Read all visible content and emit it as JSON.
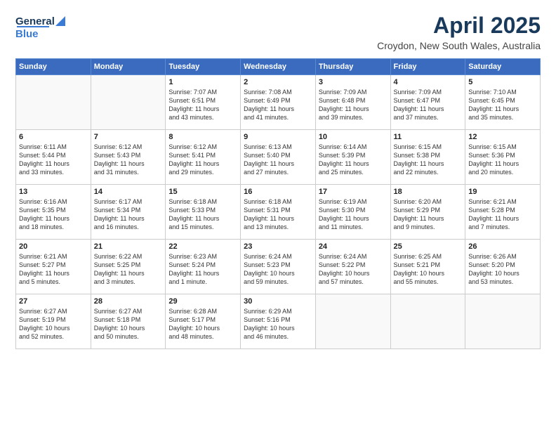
{
  "header": {
    "logo_general": "General",
    "logo_blue": "Blue",
    "title": "April 2025",
    "subtitle": "Croydon, New South Wales, Australia"
  },
  "weekdays": [
    "Sunday",
    "Monday",
    "Tuesday",
    "Wednesday",
    "Thursday",
    "Friday",
    "Saturday"
  ],
  "weeks": [
    [
      {
        "day": "",
        "lines": []
      },
      {
        "day": "",
        "lines": []
      },
      {
        "day": "1",
        "lines": [
          "Sunrise: 7:07 AM",
          "Sunset: 6:51 PM",
          "Daylight: 11 hours",
          "and 43 minutes."
        ]
      },
      {
        "day": "2",
        "lines": [
          "Sunrise: 7:08 AM",
          "Sunset: 6:49 PM",
          "Daylight: 11 hours",
          "and 41 minutes."
        ]
      },
      {
        "day": "3",
        "lines": [
          "Sunrise: 7:09 AM",
          "Sunset: 6:48 PM",
          "Daylight: 11 hours",
          "and 39 minutes."
        ]
      },
      {
        "day": "4",
        "lines": [
          "Sunrise: 7:09 AM",
          "Sunset: 6:47 PM",
          "Daylight: 11 hours",
          "and 37 minutes."
        ]
      },
      {
        "day": "5",
        "lines": [
          "Sunrise: 7:10 AM",
          "Sunset: 6:45 PM",
          "Daylight: 11 hours",
          "and 35 minutes."
        ]
      }
    ],
    [
      {
        "day": "6",
        "lines": [
          "Sunrise: 6:11 AM",
          "Sunset: 5:44 PM",
          "Daylight: 11 hours",
          "and 33 minutes."
        ]
      },
      {
        "day": "7",
        "lines": [
          "Sunrise: 6:12 AM",
          "Sunset: 5:43 PM",
          "Daylight: 11 hours",
          "and 31 minutes."
        ]
      },
      {
        "day": "8",
        "lines": [
          "Sunrise: 6:12 AM",
          "Sunset: 5:41 PM",
          "Daylight: 11 hours",
          "and 29 minutes."
        ]
      },
      {
        "day": "9",
        "lines": [
          "Sunrise: 6:13 AM",
          "Sunset: 5:40 PM",
          "Daylight: 11 hours",
          "and 27 minutes."
        ]
      },
      {
        "day": "10",
        "lines": [
          "Sunrise: 6:14 AM",
          "Sunset: 5:39 PM",
          "Daylight: 11 hours",
          "and 25 minutes."
        ]
      },
      {
        "day": "11",
        "lines": [
          "Sunrise: 6:15 AM",
          "Sunset: 5:38 PM",
          "Daylight: 11 hours",
          "and 22 minutes."
        ]
      },
      {
        "day": "12",
        "lines": [
          "Sunrise: 6:15 AM",
          "Sunset: 5:36 PM",
          "Daylight: 11 hours",
          "and 20 minutes."
        ]
      }
    ],
    [
      {
        "day": "13",
        "lines": [
          "Sunrise: 6:16 AM",
          "Sunset: 5:35 PM",
          "Daylight: 11 hours",
          "and 18 minutes."
        ]
      },
      {
        "day": "14",
        "lines": [
          "Sunrise: 6:17 AM",
          "Sunset: 5:34 PM",
          "Daylight: 11 hours",
          "and 16 minutes."
        ]
      },
      {
        "day": "15",
        "lines": [
          "Sunrise: 6:18 AM",
          "Sunset: 5:33 PM",
          "Daylight: 11 hours",
          "and 15 minutes."
        ]
      },
      {
        "day": "16",
        "lines": [
          "Sunrise: 6:18 AM",
          "Sunset: 5:31 PM",
          "Daylight: 11 hours",
          "and 13 minutes."
        ]
      },
      {
        "day": "17",
        "lines": [
          "Sunrise: 6:19 AM",
          "Sunset: 5:30 PM",
          "Daylight: 11 hours",
          "and 11 minutes."
        ]
      },
      {
        "day": "18",
        "lines": [
          "Sunrise: 6:20 AM",
          "Sunset: 5:29 PM",
          "Daylight: 11 hours",
          "and 9 minutes."
        ]
      },
      {
        "day": "19",
        "lines": [
          "Sunrise: 6:21 AM",
          "Sunset: 5:28 PM",
          "Daylight: 11 hours",
          "and 7 minutes."
        ]
      }
    ],
    [
      {
        "day": "20",
        "lines": [
          "Sunrise: 6:21 AM",
          "Sunset: 5:27 PM",
          "Daylight: 11 hours",
          "and 5 minutes."
        ]
      },
      {
        "day": "21",
        "lines": [
          "Sunrise: 6:22 AM",
          "Sunset: 5:25 PM",
          "Daylight: 11 hours",
          "and 3 minutes."
        ]
      },
      {
        "day": "22",
        "lines": [
          "Sunrise: 6:23 AM",
          "Sunset: 5:24 PM",
          "Daylight: 11 hours",
          "and 1 minute."
        ]
      },
      {
        "day": "23",
        "lines": [
          "Sunrise: 6:24 AM",
          "Sunset: 5:23 PM",
          "Daylight: 10 hours",
          "and 59 minutes."
        ]
      },
      {
        "day": "24",
        "lines": [
          "Sunrise: 6:24 AM",
          "Sunset: 5:22 PM",
          "Daylight: 10 hours",
          "and 57 minutes."
        ]
      },
      {
        "day": "25",
        "lines": [
          "Sunrise: 6:25 AM",
          "Sunset: 5:21 PM",
          "Daylight: 10 hours",
          "and 55 minutes."
        ]
      },
      {
        "day": "26",
        "lines": [
          "Sunrise: 6:26 AM",
          "Sunset: 5:20 PM",
          "Daylight: 10 hours",
          "and 53 minutes."
        ]
      }
    ],
    [
      {
        "day": "27",
        "lines": [
          "Sunrise: 6:27 AM",
          "Sunset: 5:19 PM",
          "Daylight: 10 hours",
          "and 52 minutes."
        ]
      },
      {
        "day": "28",
        "lines": [
          "Sunrise: 6:27 AM",
          "Sunset: 5:18 PM",
          "Daylight: 10 hours",
          "and 50 minutes."
        ]
      },
      {
        "day": "29",
        "lines": [
          "Sunrise: 6:28 AM",
          "Sunset: 5:17 PM",
          "Daylight: 10 hours",
          "and 48 minutes."
        ]
      },
      {
        "day": "30",
        "lines": [
          "Sunrise: 6:29 AM",
          "Sunset: 5:16 PM",
          "Daylight: 10 hours",
          "and 46 minutes."
        ]
      },
      {
        "day": "",
        "lines": []
      },
      {
        "day": "",
        "lines": []
      },
      {
        "day": "",
        "lines": []
      }
    ]
  ]
}
